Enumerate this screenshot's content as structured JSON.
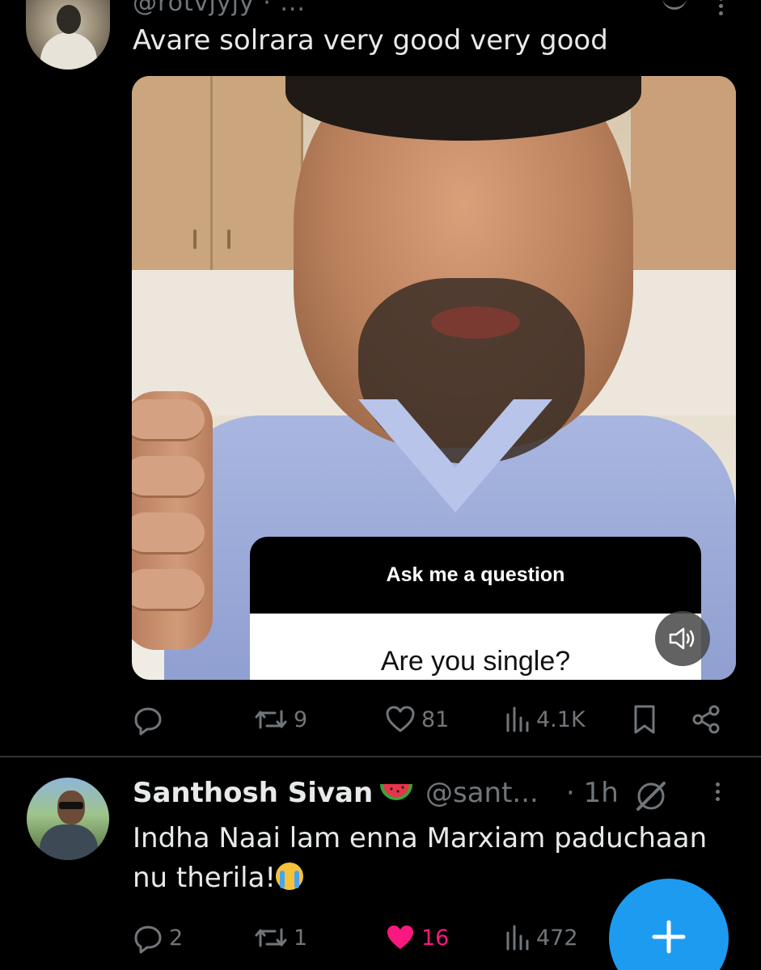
{
  "tweet1": {
    "handle_cut": "@rotvjyjy · ...",
    "text": "Avare solrara very good very good",
    "media": {
      "overlay_card_title": "Ask me a question",
      "overlay_card_question": "Are you single?",
      "mute_icon": "volume-icon"
    },
    "actions": {
      "reply_count": "",
      "retweet_count": "9",
      "like_count": "81",
      "views_count": "4.1K"
    }
  },
  "tweet2": {
    "name": "Santhosh Sivan",
    "name_emoji": "watermelon",
    "handle": "@sant...",
    "time": "· 1h",
    "text": "Indha Naai lam enna Marxiam paduchaan nu therila!",
    "text_emoji": "crying-face",
    "actions": {
      "reply_count": "2",
      "retweet_count": "1",
      "like_count": "16",
      "views_count": "472",
      "liked": true
    }
  },
  "colors": {
    "background": "#000000",
    "text_primary": "#e7e9ea",
    "text_secondary": "#71767b",
    "accent": "#1d9bf0",
    "like_active": "#f91880"
  }
}
